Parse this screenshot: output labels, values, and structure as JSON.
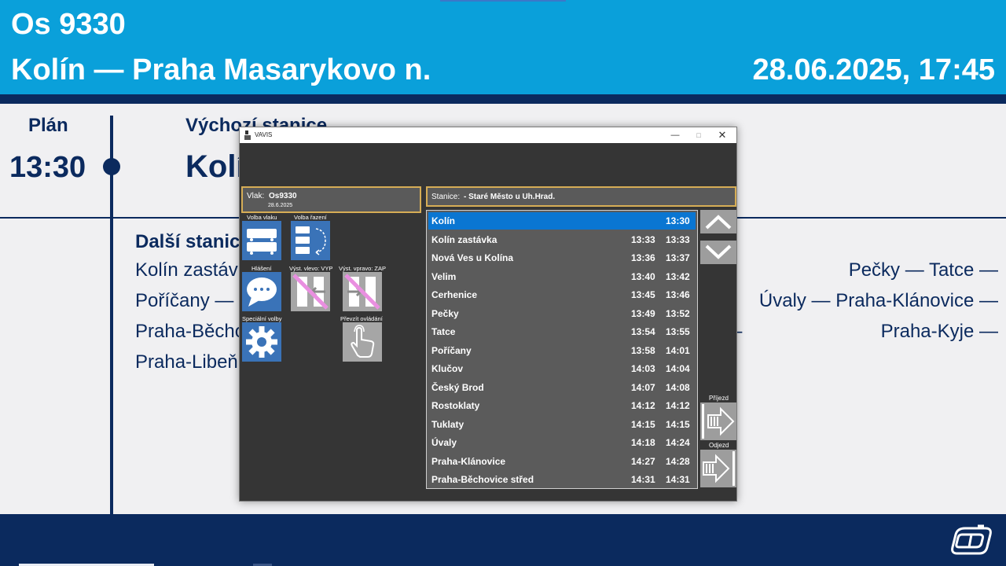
{
  "display": {
    "train_number": "Os 9330",
    "route": "Kolín — Praha Masarykovo n.",
    "datetime": "28.06.2025, 17:45",
    "plan_label": "Plán",
    "plan_time": "13:30",
    "origin_label": "Výchozí stanice",
    "origin_name": "Kolín",
    "next_label": "Další stanice",
    "next_lines": [
      {
        "left": "Kolín zastávka — Nová Ves u Kolína — Velim — Cerhenice —",
        "right": "Pečky — Tatce —"
      },
      {
        "left": "Poříčany — Klučov — Český Brod — Rostoklaty — Tuklaty —",
        "right": "Úvaly — Praha-Klánovice —"
      },
      {
        "left": "Praha-Běchovice střed — Praha-Běchovice — Praha-Dolní Počernice —",
        "right": "Praha-Kyje —"
      },
      {
        "left": "Praha-Libeň — Praha Masarykovo n.",
        "right": ""
      }
    ]
  },
  "colors": {
    "header_blue": "#0aa0da",
    "navy": "#0b2a5e",
    "selected_row": "#0a76d2",
    "frame_gold": "#d6ad56"
  },
  "logo": {
    "icon": "cd-logo-icon"
  },
  "vavis": {
    "window_title": "VAVIS",
    "window_controls": {
      "minimize": "—",
      "maximize": "□",
      "close": "✕"
    },
    "train_label": "Vlak:",
    "train_value": "Os9330",
    "train_date": "28.6.2025",
    "tools": [
      {
        "label": "Volba vlaku",
        "icon": "train-select-icon"
      },
      {
        "label": "Volba řazení",
        "icon": "train-order-icon"
      },
      {
        "label": "Hlášení",
        "icon": "announcement-icon"
      },
      {
        "label": "Výst. vlevo: VYP",
        "icon": "exit-left-disabled-icon"
      },
      {
        "label": "Výst. vpravo: ZAP",
        "icon": "exit-right-disabled-icon"
      },
      {
        "label": "Speciální volby",
        "icon": "settings-gear-icon"
      },
      {
        "label": "Převzít ovládání",
        "icon": "take-control-hand-icon"
      }
    ],
    "station_label": "Stanice:",
    "station_value": "- Staré Město u Uh.Hrad.",
    "stops": [
      {
        "name": "Kolín",
        "arr": "",
        "dep": "13:30"
      },
      {
        "name": "Kolín zastávka",
        "arr": "13:33",
        "dep": "13:33"
      },
      {
        "name": "Nová Ves u Kolína",
        "arr": "13:36",
        "dep": "13:37"
      },
      {
        "name": "Velim",
        "arr": "13:40",
        "dep": "13:42"
      },
      {
        "name": "Cerhenice",
        "arr": "13:45",
        "dep": "13:46"
      },
      {
        "name": "Pečky",
        "arr": "13:49",
        "dep": "13:52"
      },
      {
        "name": "Tatce",
        "arr": "13:54",
        "dep": "13:55"
      },
      {
        "name": "Poříčany",
        "arr": "13:58",
        "dep": "14:01"
      },
      {
        "name": "Klučov",
        "arr": "14:03",
        "dep": "14:04"
      },
      {
        "name": "Český Brod",
        "arr": "14:07",
        "dep": "14:08"
      },
      {
        "name": "Rostoklaty",
        "arr": "14:12",
        "dep": "14:12"
      },
      {
        "name": "Tuklaty",
        "arr": "14:15",
        "dep": "14:15"
      },
      {
        "name": "Úvaly",
        "arr": "14:18",
        "dep": "14:24"
      },
      {
        "name": "Praha-Klánovice",
        "arr": "14:27",
        "dep": "14:28"
      },
      {
        "name": "Praha-Běchovice střed",
        "arr": "14:31",
        "dep": "14:31"
      }
    ],
    "selected_stop": 0,
    "arrival_label": "Příjezd",
    "departure_label": "Odjezd"
  }
}
